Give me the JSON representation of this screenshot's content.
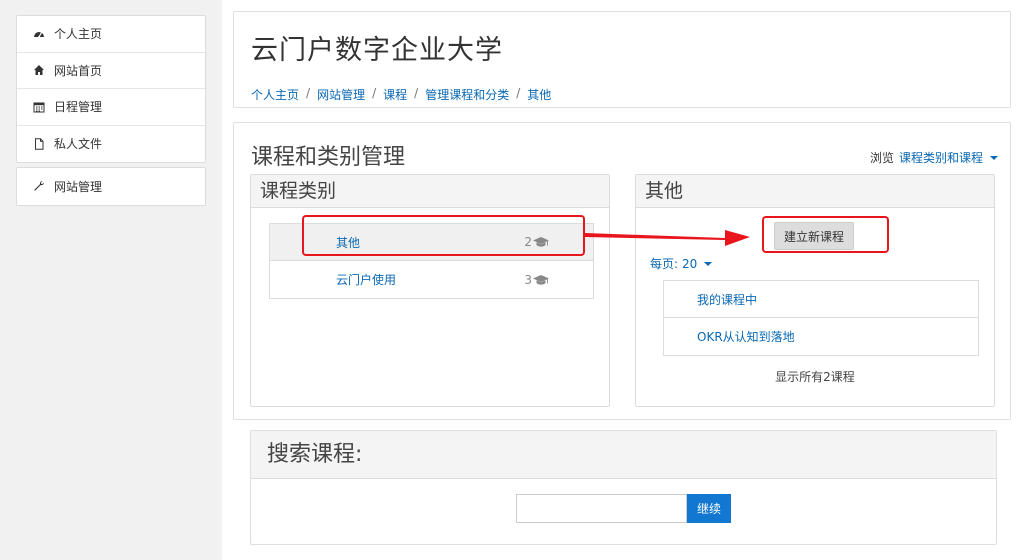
{
  "sidebar": {
    "items": [
      {
        "label": "个人主页",
        "icon": "dashboard-icon"
      },
      {
        "label": "网站首页",
        "icon": "home-icon"
      },
      {
        "label": "日程管理",
        "icon": "calendar-icon"
      },
      {
        "label": "私人文件",
        "icon": "file-icon"
      }
    ],
    "admin": {
      "label": "网站管理",
      "icon": "wrench-icon"
    }
  },
  "header": {
    "title": "云门户数字企业大学",
    "breadcrumb": [
      "个人主页",
      "网站管理",
      "课程",
      "管理课程和分类",
      "其他"
    ],
    "separator": "/"
  },
  "manage": {
    "title": "课程和类别管理",
    "browse_label": "浏览",
    "browse_value": "课程类别和课程"
  },
  "categories": {
    "title": "课程类别",
    "items": [
      {
        "name": "其他",
        "count": "2"
      },
      {
        "name": "云门户使用",
        "count": "3"
      }
    ]
  },
  "other": {
    "title": "其他",
    "new_course_label": "建立新课程",
    "perpage_label": "每页:",
    "perpage_value": "20",
    "courses": [
      "我的课程中",
      "OKR从认知到落地"
    ],
    "show_all": "显示所有2课程"
  },
  "search": {
    "title": "搜索课程:",
    "input_value": "",
    "button_label": "继续"
  },
  "colors": {
    "link": "#0a68b4",
    "primary_button": "#1177d1",
    "annotation_red": "#e8151c"
  }
}
